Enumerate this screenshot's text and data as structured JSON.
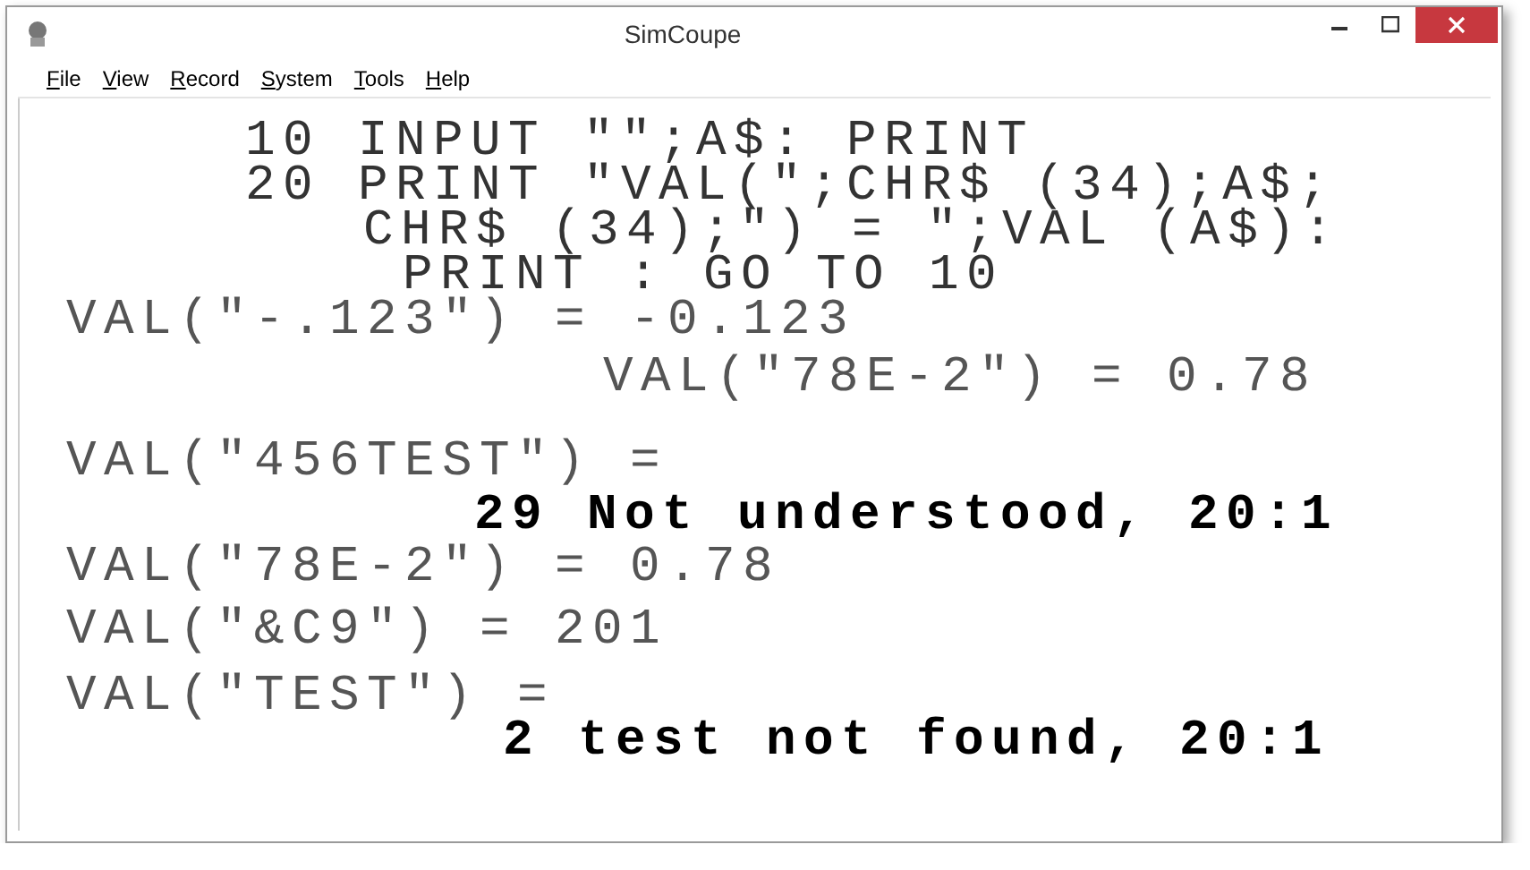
{
  "window": {
    "title": "SimCoupe"
  },
  "menu": [
    {
      "label": "File"
    },
    {
      "label": "View"
    },
    {
      "label": "Record"
    },
    {
      "label": "System"
    },
    {
      "label": "Tools"
    },
    {
      "label": "Help"
    }
  ],
  "screen_lines": [
    {
      "kind": "listing",
      "text": "10 INPUT \"\";A$: PRINT"
    },
    {
      "kind": "listing",
      "text": "20 PRINT \"VAL(\";CHR$ (34);A$;"
    },
    {
      "kind": "listing",
      "text": "CHR$ (34);\") = \";VAL (A$):"
    },
    {
      "kind": "listing",
      "text": "PRINT : GO TO 10"
    },
    {
      "kind": "output",
      "text": "VAL(\"-.123\") = -0.123"
    },
    {
      "kind": "output",
      "text": "VAL(\"78E-2\") = 0.78"
    },
    {
      "kind": "output",
      "text": "VAL(\"456TEST\") ="
    },
    {
      "kind": "error",
      "text": "29 Not understood, 20:1"
    },
    {
      "kind": "output",
      "text": "VAL(\"78E-2\") = 0.78"
    },
    {
      "kind": "output",
      "text": "VAL(\"&C9\") = 201"
    },
    {
      "kind": "output",
      "text": "VAL(\"TEST\") ="
    },
    {
      "kind": "error",
      "text": "2 test not found, 20:1"
    }
  ]
}
